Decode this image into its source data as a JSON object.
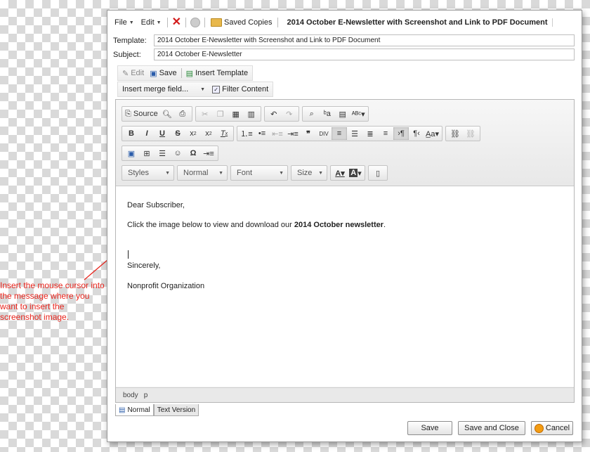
{
  "menubar": {
    "file": "File",
    "edit": "Edit",
    "saved_copies": "Saved Copies",
    "doc_title": "2014 October E-Newsletter with Screenshot and Link to PDF Document"
  },
  "template": {
    "label": "Template:",
    "value": "2014 October E-Newsletter with Screenshot and Link to PDF Document"
  },
  "subject": {
    "label": "Subject:",
    "value": "2014 October E-Newsletter"
  },
  "content_toolbar": {
    "edit": "Edit",
    "save": "Save",
    "insert_template": "Insert Template"
  },
  "merge_bar": {
    "insert_merge_field": "Insert merge field...",
    "filter_content": "Filter Content"
  },
  "editor_toolbar": {
    "source": "Source",
    "styles": "Styles",
    "format": "Normal",
    "font": "Font",
    "size": "Size"
  },
  "message": {
    "greeting": "Dear Subscriber,",
    "line_before": "Click the image below to view and download our ",
    "line_bold": "2014 October newsletter",
    "line_after": ".",
    "closing": "Sincerely,",
    "signature": "Nonprofit Organization"
  },
  "pathbar": {
    "items": [
      "body",
      "p"
    ]
  },
  "tabs": {
    "normal": "Normal",
    "text_version": "Text Version"
  },
  "buttons": {
    "save": "Save",
    "save_close": "Save and Close",
    "cancel": "Cancel"
  },
  "annotation": "Insert the mouse cursor into the message where you want to insert the screenshot image.",
  "colors": {
    "annotation": "#e8241c",
    "arrow": "#e8241c"
  }
}
